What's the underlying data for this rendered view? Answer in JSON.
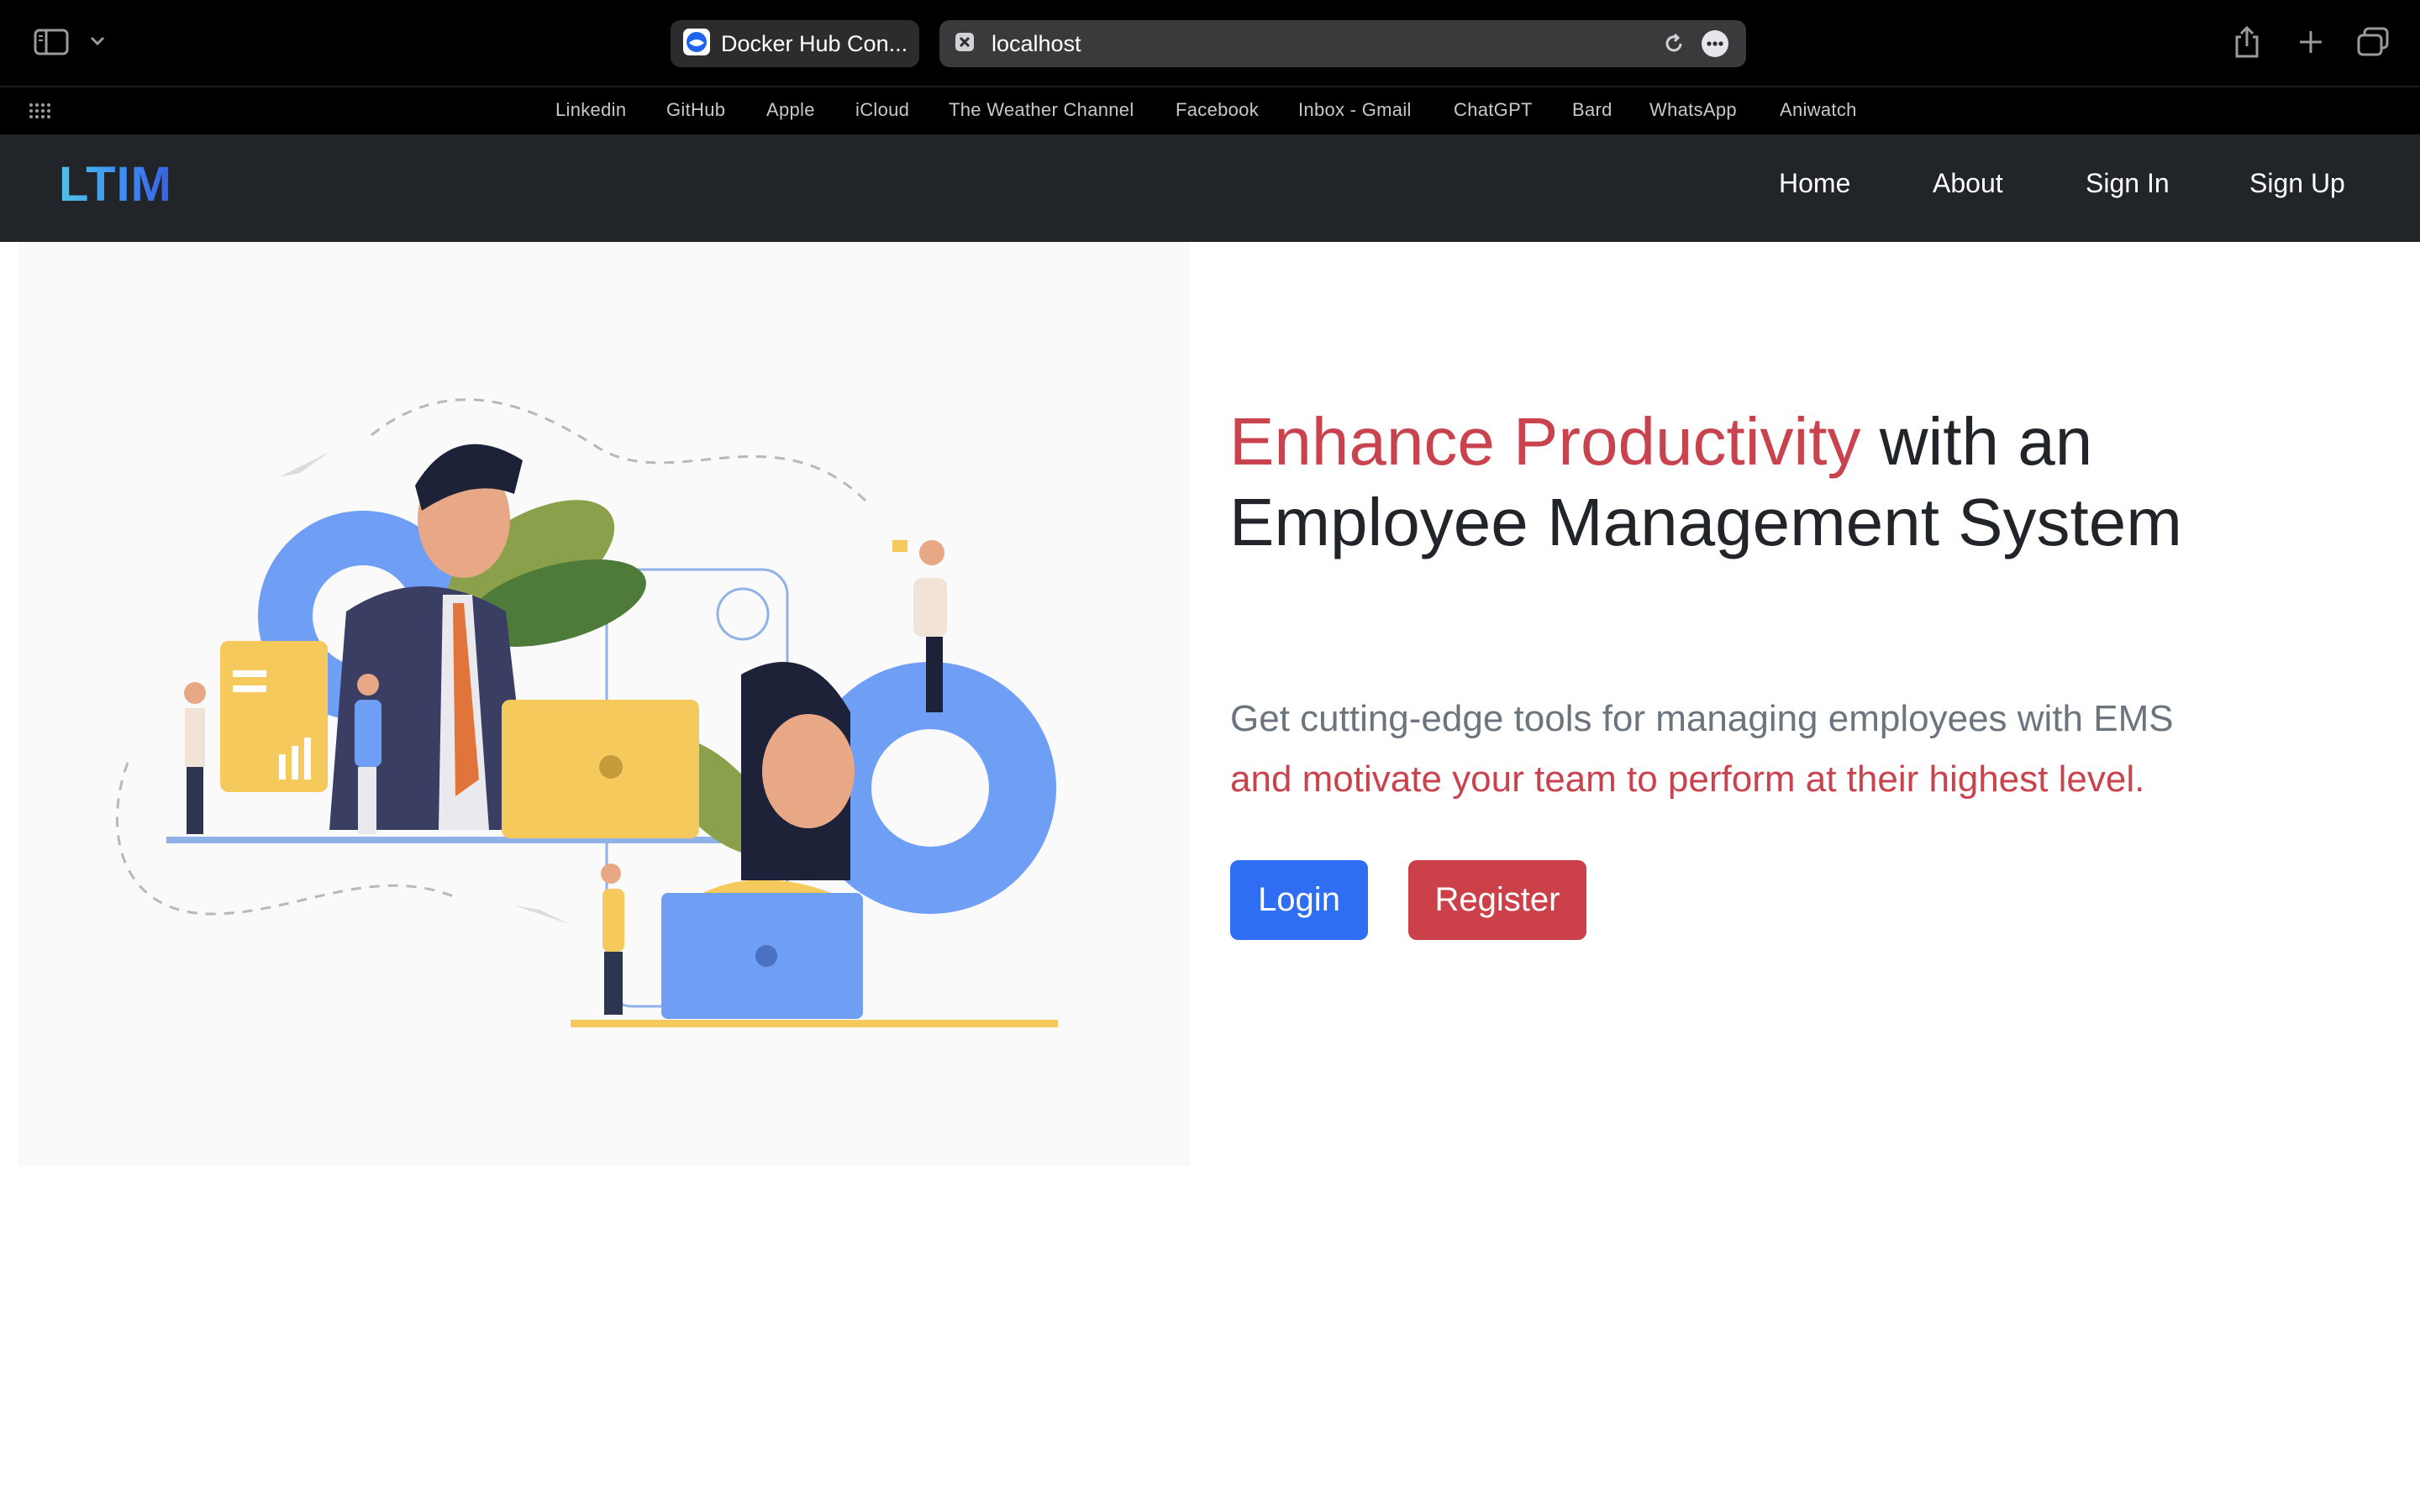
{
  "browser": {
    "tabs": [
      {
        "title": "Docker Hub Con..."
      },
      {
        "title": "localhost"
      }
    ],
    "bookmarks": [
      "Linkedin",
      "GitHub",
      "Apple",
      "iCloud",
      "The Weather Channel",
      "Facebook",
      "Inbox - Gmail",
      "ChatGPT",
      "Bard",
      "WhatsApp",
      "Aniwatch"
    ],
    "icons": [
      "sidebar-icon",
      "chevron-down-icon",
      "docker-icon",
      "close-icon",
      "reload-icon",
      "more-icon",
      "share-icon",
      "plus-icon",
      "tabs-overview-icon",
      "apps-grid-icon"
    ]
  },
  "navbar": {
    "brand": "LTIM",
    "links": [
      "Home",
      "About",
      "Sign In",
      "Sign Up"
    ]
  },
  "hero": {
    "headline_highlight": "Enhance Productivity",
    "headline_rest": " with an Employee Management System",
    "subtitle_line1": "Get cutting-edge tools for managing employees with EMS",
    "subtitle_line2": "and motivate your team to perform at their highest level.",
    "login_label": "Login",
    "register_label": "Register"
  },
  "colors": {
    "navbar_bg": "#212529",
    "accent_red": "#c9434f",
    "login_blue": "#2f6ef3",
    "register_red": "#cc4049"
  }
}
